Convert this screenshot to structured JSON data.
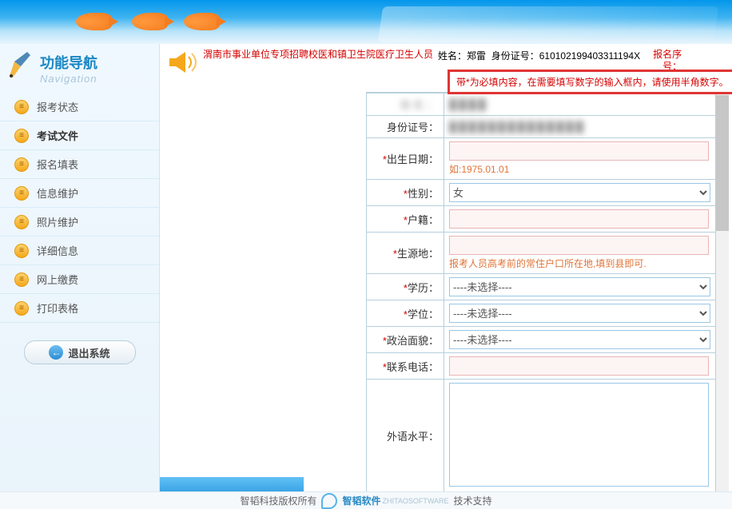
{
  "nav": {
    "title": "功能导航",
    "subtitle": "Navigation",
    "items": [
      {
        "label": "报考状态"
      },
      {
        "label": "考试文件"
      },
      {
        "label": "报名填表"
      },
      {
        "label": "信息维护"
      },
      {
        "label": "照片维护"
      },
      {
        "label": "详细信息"
      },
      {
        "label": "网上缴费"
      },
      {
        "label": "打印表格"
      }
    ],
    "logout": "退出系统"
  },
  "header": {
    "notice_title": "渭南市事业单位专项招聘校医和镇卫生院医疗卫生人员",
    "name_lbl": "姓名：",
    "name_val": "郑雷",
    "id_lbl": "身份证号：",
    "id_val": "610102199403311194X",
    "reg_lbl": "报名序号：",
    "red_notice": "带*为必填内容，在需要填写数字的输入框内，请使用半角数字。"
  },
  "form": {
    "name_lbl": "姓名：",
    "id_lbl": "身份证号：",
    "birth_lbl": "出生日期：",
    "birth_hint": "如:1975.01.01",
    "gender_lbl": "性别：",
    "gender_val": "女",
    "huji_lbl": "户籍：",
    "origin_lbl": "生源地：",
    "origin_hint": "报考人员高考前的常住户口所在地,填到县即可.",
    "edu_lbl": "学历：",
    "edu_val": "----未选择----",
    "degree_lbl": "学位：",
    "degree_val": "----未选择----",
    "politics_lbl": "政治面貌：",
    "politics_val": "----未选择----",
    "phone_lbl": "联系电话：",
    "lang_lbl": "外语水平："
  },
  "footer": {
    "copyright": "智韬科技版权所有",
    "brand": "智韬软件",
    "brand_sub": "ZHITAOSOFTWARE",
    "support": "技术支持"
  }
}
